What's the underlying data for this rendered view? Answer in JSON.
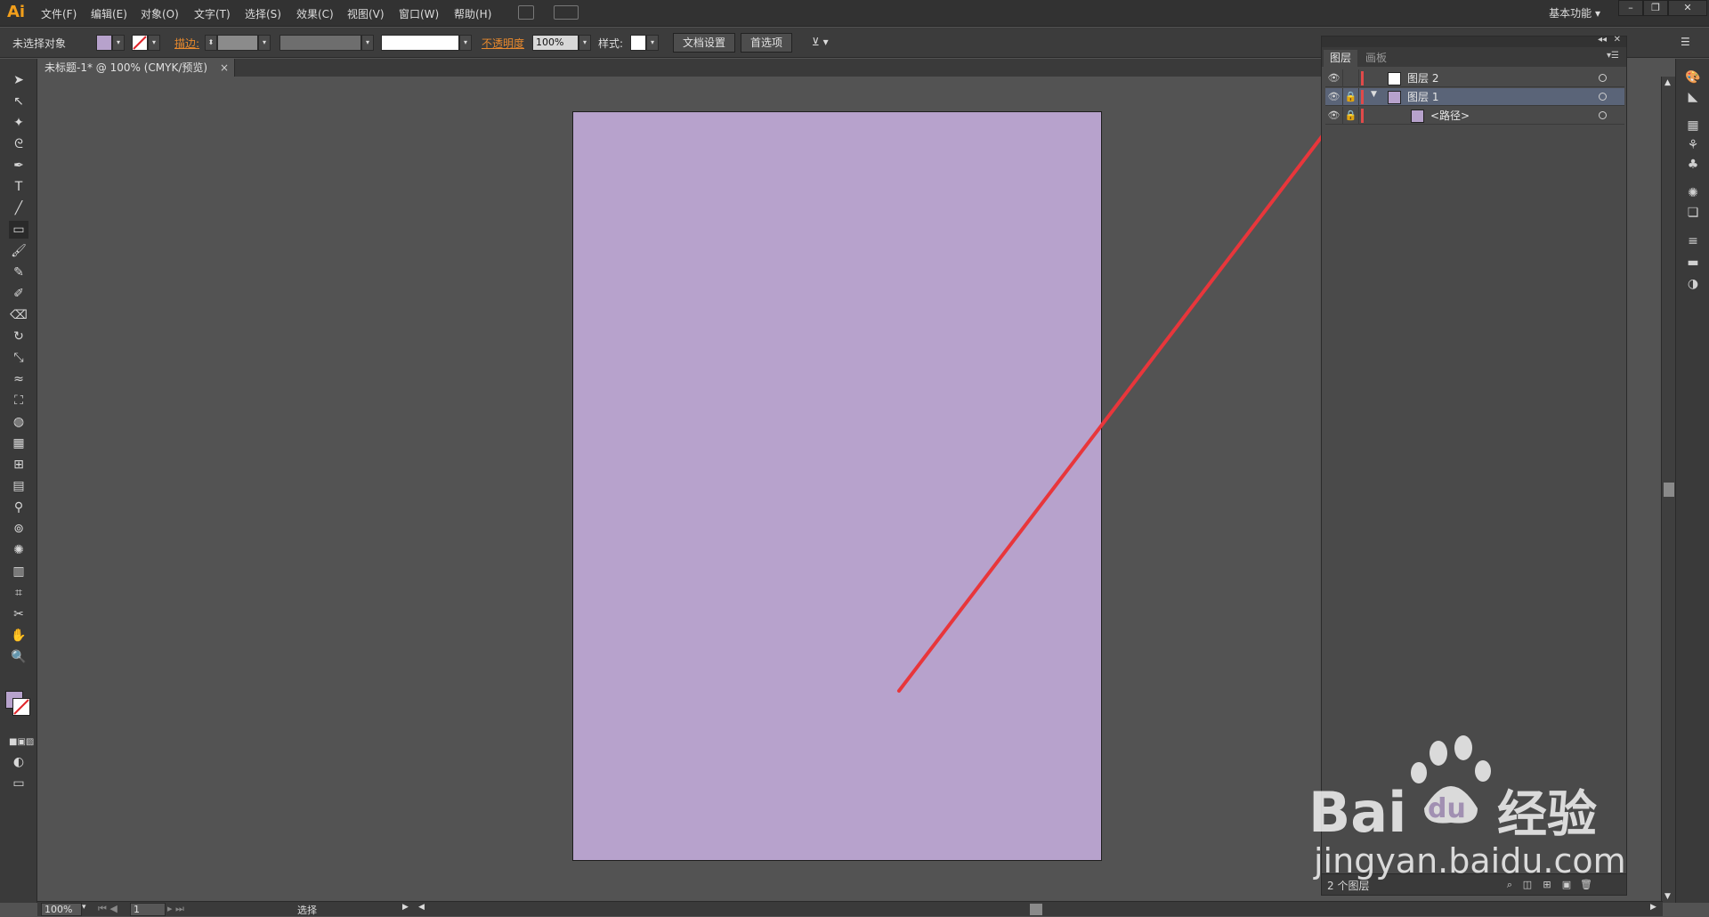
{
  "app": {
    "logo": "Ai",
    "brand_color": "#f29f1b"
  },
  "menu": {
    "items": [
      "文件(F)",
      "编辑(E)",
      "对象(O)",
      "文字(T)",
      "选择(S)",
      "效果(C)",
      "视图(V)",
      "窗口(W)",
      "帮助(H)"
    ],
    "workspace": "基本功能",
    "workspace_arrow": "▾"
  },
  "control": {
    "selection_status": "未选择对象",
    "stroke_label": "描边:",
    "opacity_label": "不透明度",
    "opacity_value": "100%",
    "style_label": "样式:",
    "doc_setup": "文档设置",
    "preferences": "首选项"
  },
  "tab": {
    "title": "未标题-1* @ 100% (CMYK/预览)",
    "close": "×"
  },
  "artboard": {
    "fill": "#b7a2cc"
  },
  "fill_color": "#b7a2cc",
  "layers_panel": {
    "tabs": [
      "图层",
      "画板"
    ],
    "layers": [
      {
        "name": "图层 2",
        "color": "#e04a4a",
        "thumb": "#ffffff"
      },
      {
        "name": "图层 1",
        "color": "#e04a4a",
        "thumb": "#b7a2cc",
        "expand": "▼"
      },
      {
        "name": "<路径>",
        "color": "#e04a4a",
        "thumb": "#b7a2cc"
      }
    ],
    "footer": "2 个图层"
  },
  "status": {
    "zoom": "100%",
    "page": "1",
    "mode": "选择"
  },
  "watermark": {
    "brand": "Bai",
    "brand2": "du",
    "cn": "经验",
    "url": "jingyan.baidu.com"
  },
  "annotation_arrow_color": "#e8363b"
}
